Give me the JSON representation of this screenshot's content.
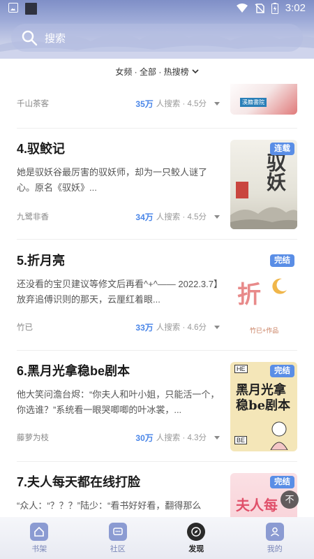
{
  "status_bar": {
    "time": "3:02"
  },
  "search": {
    "placeholder": "搜索"
  },
  "filter": {
    "label": "女频 · 全部 · 热搜榜"
  },
  "items": [
    {
      "rank_title": "",
      "description": "",
      "author": "千山茶客",
      "search_count": "35万",
      "meta_rest": "人搜索 · 4.5分",
      "badge": "",
      "cover_text": "",
      "cover_publisher": "溪籍書院"
    },
    {
      "rank_title": "4.驭鲛记",
      "description": "她是驭妖谷最厉害的驭妖师，却为一只鲛人谜了心。原名《驭妖》...",
      "author": "九鹭非香",
      "search_count": "34万",
      "meta_rest": "人搜索 · 4.5分",
      "badge": "连载",
      "cover_text": "驭妖"
    },
    {
      "rank_title": "5.折月亮",
      "description": "还没看的宝贝建议等修文后再看^+^—— 2022.3.7】放弃追傅识则的那天，云厘红着眼...",
      "author": "竹已",
      "search_count": "33万",
      "meta_rest": "人搜索 · 4.6分",
      "badge": "完结",
      "cover_text": "折",
      "cover_sub": "竹已+作品"
    },
    {
      "rank_title": "6.黑月光拿稳be剧本",
      "description": "他大笑问澹台烬：“你夫人和叶小姐，只能活一个，你选谁？”系统看一眼哭唧唧的叶冰裳，...",
      "author": "藤萝为枝",
      "search_count": "30万",
      "meta_rest": "人搜索 · 4.3分",
      "badge": "完结",
      "cover_text": "黑月光拿稳be剧本"
    },
    {
      "rank_title": "7.夫人每天都在线打脸",
      "description": "“众人：“？？？”陆少：“看书好好看，翻得那么",
      "author": "",
      "search_count": "",
      "meta_rest": "",
      "badge": "完结",
      "cover_text": "夫人每"
    }
  ],
  "float_button": {
    "label": "不"
  },
  "bottom_tabs": [
    {
      "label": "书架",
      "icon": "bookshelf-icon"
    },
    {
      "label": "社区",
      "icon": "community-icon"
    },
    {
      "label": "发现",
      "icon": "compass-icon"
    },
    {
      "label": "我的",
      "icon": "profile-icon"
    }
  ],
  "colors": {
    "accent": "#4a86e8",
    "badge": "#5a8ee6",
    "tab_inactive": "#7a86b8"
  }
}
